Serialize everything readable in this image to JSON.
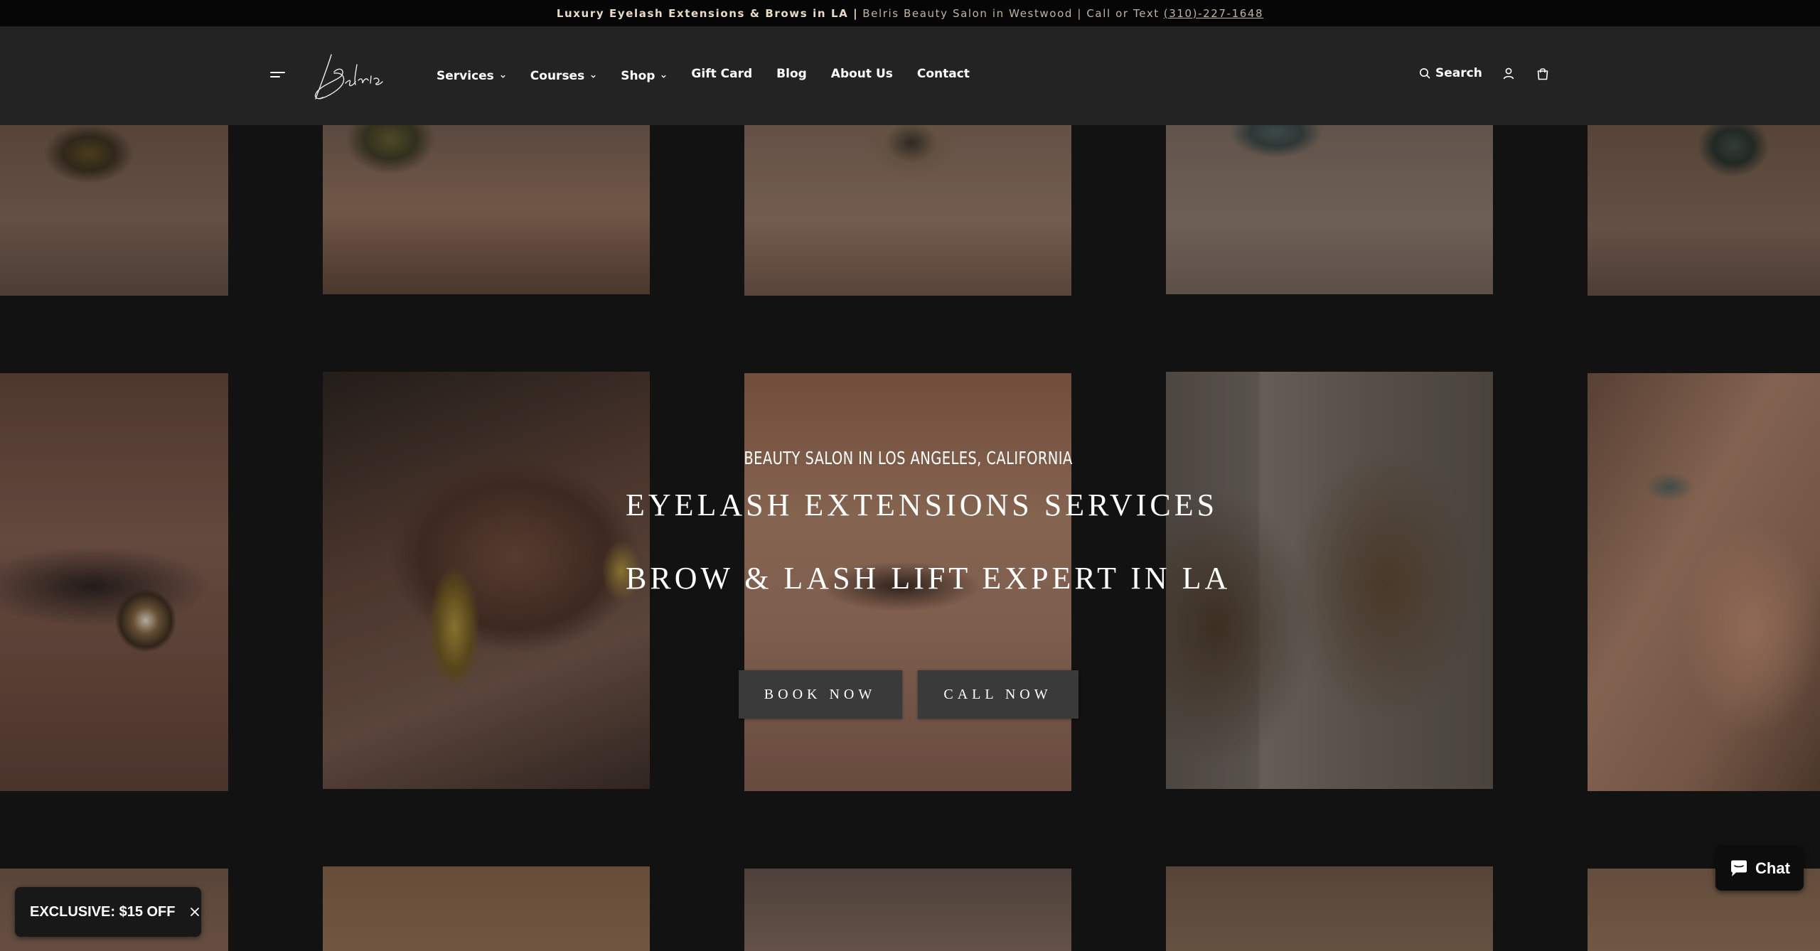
{
  "announcement": {
    "bold": "Luxury Eyelash Extensions & Brows in LA |",
    "rest": "Belris Beauty Salon in Westwood | Call or Text",
    "phone": "(310)-227-1648"
  },
  "header": {
    "logo_text": "Belris",
    "nav": [
      {
        "label": "Services",
        "dropdown": true
      },
      {
        "label": "Courses",
        "dropdown": true
      },
      {
        "label": "Shop",
        "dropdown": true
      },
      {
        "label": "Gift Card",
        "dropdown": false
      },
      {
        "label": "Blog",
        "dropdown": false
      },
      {
        "label": "About Us",
        "dropdown": false
      },
      {
        "label": "Contact",
        "dropdown": false
      }
    ],
    "search_label": "Search",
    "icons": [
      "menu-icon",
      "search-icon",
      "account-icon",
      "cart-icon",
      "chevron-down-icon"
    ]
  },
  "hero": {
    "subtitle": "BEAUTY SALON IN LOS ANGELES, CALIFORNIA",
    "line1": "EYELASH EXTENSIONS SERVICES",
    "line2": "BROW & LASH LIFT EXPERT IN LA",
    "book_label": "BOOK NOW",
    "call_label": "CALL NOW"
  },
  "discount": {
    "label": "EXCLUSIVE: $15 OFF"
  },
  "chat": {
    "label": "Chat"
  },
  "colors": {
    "page_bg": "#121212",
    "header_bg": "#232323",
    "announce_bg": "#060606",
    "announce_accent": "#e9d9c5",
    "button_bg": "#3a3a3a"
  }
}
